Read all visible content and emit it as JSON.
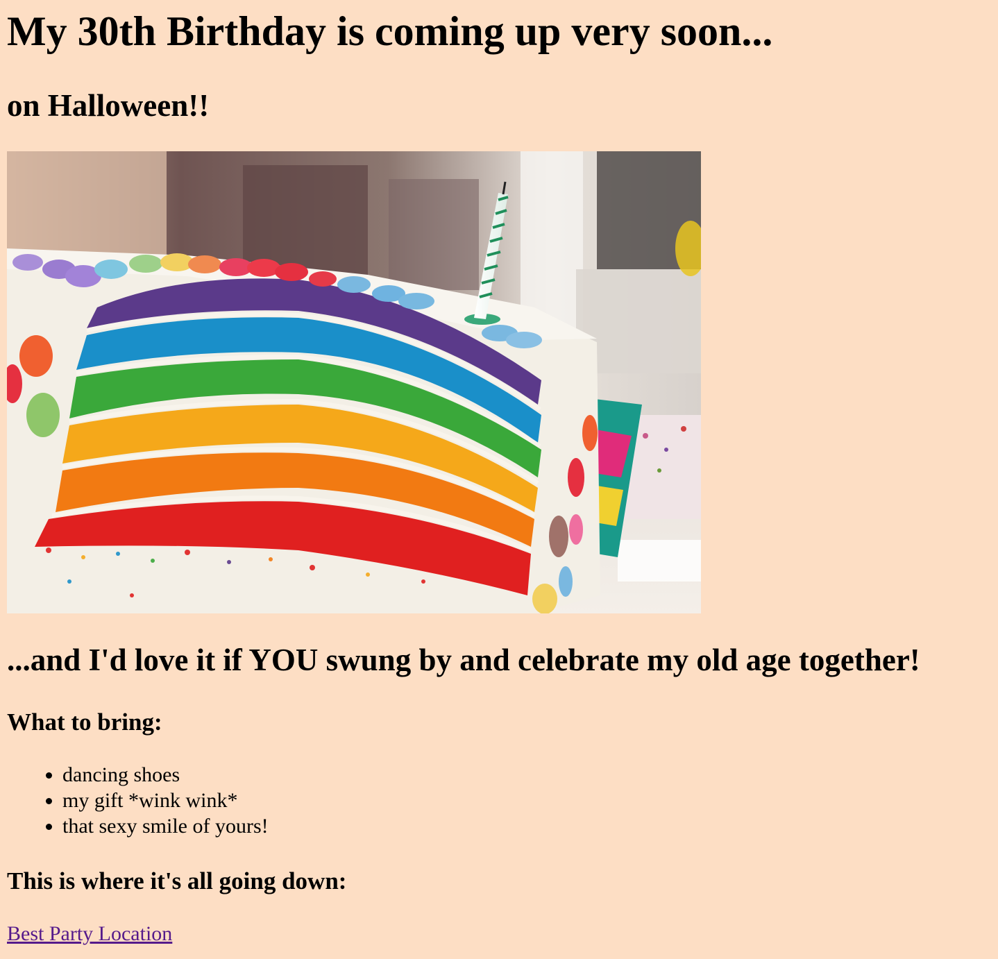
{
  "header": {
    "title": "My 30th Birthday is coming up very soon...",
    "subtitle": "on Halloween!!"
  },
  "hero_image": {
    "subject": "rainbow-layer-cake-photo",
    "colors": {
      "background": "#fddec4",
      "cake_purple": "#5b3a8a",
      "cake_blue": "#1a8fc9",
      "cake_green": "#3aa83a",
      "cake_yellow": "#f5a81a",
      "cake_orange": "#f27a12",
      "cake_red": "#e02020",
      "frosting": "#f3efe6"
    }
  },
  "invite": {
    "text": "...and I'd love it if YOU swung by and celebrate my old age together!"
  },
  "bring": {
    "heading": "What to bring:",
    "items": [
      {
        "label": "dancing shoes"
      },
      {
        "label": "my gift *wink wink*"
      },
      {
        "label": "that sexy smile of yours!"
      }
    ]
  },
  "location": {
    "heading": "This is where it's all going down:",
    "link_label": "Best Party Location",
    "link_color": "#551a8b"
  }
}
